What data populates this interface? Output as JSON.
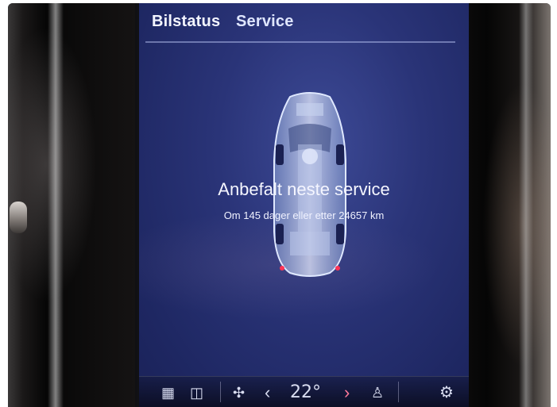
{
  "header": {
    "tabs": [
      {
        "label": "Bilstatus"
      },
      {
        "label": "Service"
      }
    ]
  },
  "service": {
    "title": "Anbefalt neste service",
    "detail": "Om 145 dager eller etter 24657 km"
  },
  "bottom_bar": {
    "temperature": "22°",
    "icons": [
      "apps-grid-icon",
      "camera-icon",
      "fan-icon",
      "chevron-left-icon",
      "chevron-right-icon",
      "seat-icon",
      "gear-icon"
    ]
  },
  "colors": {
    "screen_bg": "#2a3478",
    "text": "#f5f6ff",
    "accent_next": "#ff7a9a"
  }
}
